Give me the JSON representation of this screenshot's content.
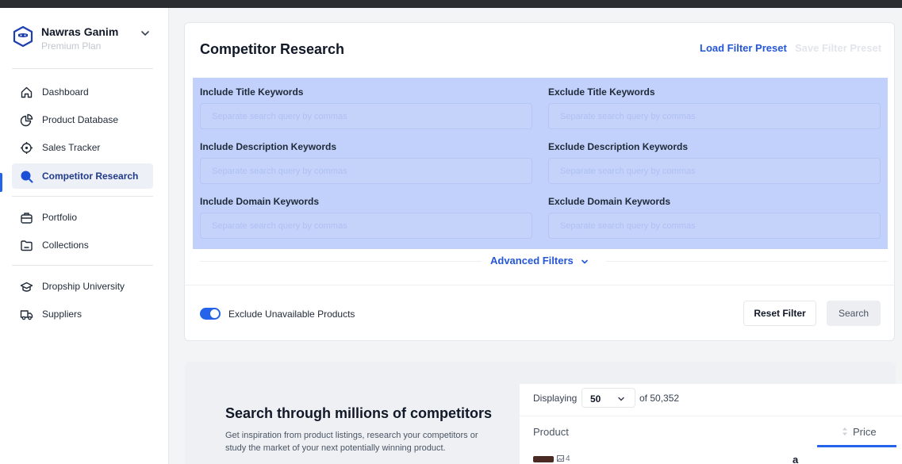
{
  "user": {
    "name": "Nawras Ganim",
    "plan": "Premium Plan"
  },
  "nav": {
    "items": [
      {
        "label": "Dashboard"
      },
      {
        "label": "Product Database"
      },
      {
        "label": "Sales Tracker"
      },
      {
        "label": "Competitor Research"
      },
      {
        "label": "Portfolio"
      },
      {
        "label": "Collections"
      },
      {
        "label": "Dropship University"
      },
      {
        "label": "Suppliers"
      }
    ],
    "active": "Competitor Research"
  },
  "research": {
    "title": "Competitor Research",
    "load_preset": "Load Filter Preset",
    "save_preset": "Save Filter Preset",
    "filters": [
      {
        "label": "Include Title Keywords",
        "value": "",
        "placeholder": "Separate search query by commas"
      },
      {
        "label": "Exclude Title Keywords",
        "value": "",
        "placeholder": "Separate search query by commas"
      },
      {
        "label": "Include Description Keywords",
        "value": "",
        "placeholder": "Separate search query by commas"
      },
      {
        "label": "Exclude Description Keywords",
        "value": "",
        "placeholder": "Separate search query by commas"
      },
      {
        "label": "Include Domain Keywords",
        "value": "",
        "placeholder": "Separate search query by commas"
      },
      {
        "label": "Exclude Domain Keywords",
        "value": "",
        "placeholder": "Separate search query by commas"
      }
    ],
    "advanced": "Advanced Filters",
    "exclude_unavailable": {
      "label": "Exclude Unavailable Products",
      "enabled": true
    },
    "reset_label": "Reset Filter",
    "search_label": "Search"
  },
  "promo": {
    "title": "Search through millions of competitors",
    "description": "Get inspiration from product listings, research your competitors or study the market of your next potentially winning product."
  },
  "table": {
    "displaying_label": "Displaying",
    "per_page": "50",
    "of_total": "of 50,352",
    "columns": {
      "product": "Product",
      "price": "Price"
    },
    "first_row": {
      "image_count": "4",
      "store_letter": "a"
    }
  },
  "colors": {
    "accent": "#2563eb",
    "link": "#2456d6",
    "selection": "#c2d1fb"
  }
}
